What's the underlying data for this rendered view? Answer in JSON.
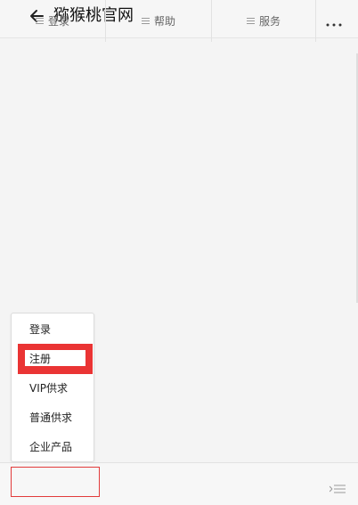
{
  "header": {
    "title": "猕猴桃官网",
    "back_icon": "arrow-left-icon",
    "more_icon": "more-dots-icon"
  },
  "popup_menu": {
    "items": [
      {
        "label": "登录"
      },
      {
        "label": "注册",
        "highlighted": true
      },
      {
        "label": "VIP供求"
      },
      {
        "label": "普通供求"
      },
      {
        "label": "企业产品"
      }
    ]
  },
  "bottom_bar": {
    "tabs": [
      {
        "label": "登录",
        "icon": "hamburger-icon",
        "active": true
      },
      {
        "label": "帮助",
        "icon": "hamburger-icon"
      },
      {
        "label": "服务",
        "icon": "hamburger-icon"
      }
    ],
    "collapse_icon": "collapse-menu-icon"
  },
  "colors": {
    "highlight": "#ea3434",
    "background": "#f4f4f4",
    "tab_text": "#666666"
  }
}
